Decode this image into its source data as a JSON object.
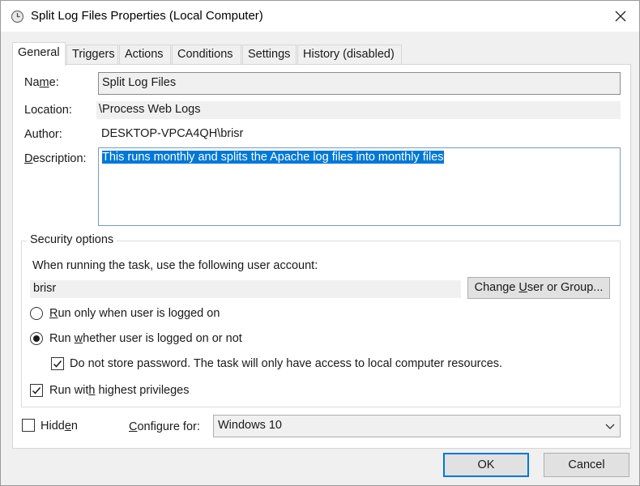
{
  "window": {
    "title": "Split Log Files Properties (Local Computer)",
    "title_icon": "clock-icon",
    "close_icon": "close-icon"
  },
  "tabs": [
    {
      "label": "General",
      "active": true
    },
    {
      "label": "Triggers",
      "active": false
    },
    {
      "label": "Actions",
      "active": false
    },
    {
      "label": "Conditions",
      "active": false
    },
    {
      "label": "Settings",
      "active": false
    },
    {
      "label": "History (disabled)",
      "active": false
    }
  ],
  "general": {
    "name_label_pre": "Na",
    "name_label_u": "m",
    "name_label_post": "e:",
    "name_value": "Split Log Files",
    "location_label": "Location:",
    "location_value": "\\Process Web Logs",
    "author_label": "Author:",
    "author_value": "DESKTOP-VPCA4QH\\brisr",
    "description_label_u": "D",
    "description_label_post": "escription:",
    "description_value": "This runs monthly and splits the Apache log files into monthly files"
  },
  "security": {
    "group_title": "Security options",
    "account_prompt": "When running the task, use the following user account:",
    "account_value": "brisr",
    "change_button_pre": "Change ",
    "change_button_u": "U",
    "change_button_post": "ser or Group...",
    "radio_logged_on_u": "R",
    "radio_logged_on_post": "un only when user is logged on",
    "radio_logged_on_selected": false,
    "radio_whether_pre": "Run ",
    "radio_whether_u": "w",
    "radio_whether_post": "hether user is logged on or not",
    "radio_whether_selected": true,
    "no_store_pwd_label": "Do not store password.  The task will only have access to local computer resources.",
    "no_store_pwd_checked": true,
    "highest_priv_pre": "Run wit",
    "highest_priv_u": "h",
    "highest_priv_post": " highest privileges",
    "highest_priv_checked": true
  },
  "footer": {
    "hidden_pre": "Hidd",
    "hidden_u": "e",
    "hidden_post": "n",
    "hidden_checked": false,
    "configure_u": "C",
    "configure_post": "onfigure for:",
    "configure_value": "Windows 10",
    "ok_label": "OK",
    "cancel_label": "Cancel"
  }
}
